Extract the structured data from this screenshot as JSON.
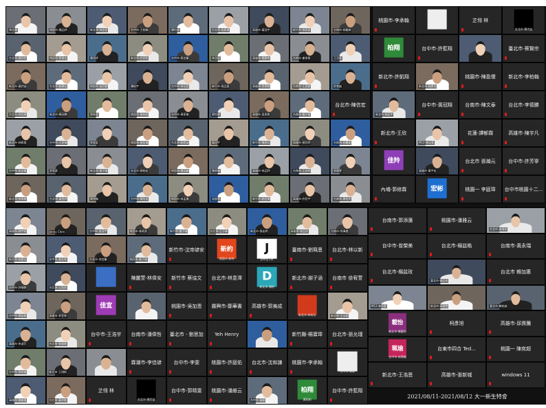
{
  "footer": {
    "caption": "2021/08/11-2021/08/12 大一新生特會"
  },
  "skin_tones": [
    "#e8c4a8",
    "#d9b294",
    "#f0d0b6",
    "#c99f80",
    "#e2bb9c"
  ],
  "video_bgs": [
    "#6b6e74",
    "#8a8d92",
    "#4d5c72",
    "#7a6b5e",
    "#5e6b7a",
    "#9aa0a6",
    "#3f4a5c",
    "#7c8591",
    "#6e655c",
    "#58636f",
    "#a49c90",
    "#4b6d8c",
    "#8c8c80",
    "#2f5e9e",
    "#6f7d6a"
  ],
  "panels": [
    {
      "id": "grid-a",
      "tiles": [
        {
          "kind": "video",
          "caption": "李佳穎"
        },
        {
          "kind": "video",
          "caption": "桃園市-陳品妤"
        },
        {
          "kind": "video",
          "caption": "新北市-林宜君"
        },
        {
          "kind": "video",
          "caption": "台中市-王柏翰"
        },
        {
          "kind": "video",
          "caption": "陳怡安"
        },
        {
          "kind": "video",
          "caption": "台北市-吳佩珊"
        },
        {
          "kind": "video",
          "caption": "高雄市-黃冠宇"
        },
        {
          "kind": "video",
          "caption": "新竹市-張家豪"
        },
        {
          "kind": "video",
          "caption": "台南市-林雅婷"
        },
        {
          "kind": "video",
          "caption": "台北市-周欣怡"
        },
        {
          "kind": "video",
          "caption": "桃園市-郭俊宏"
        },
        {
          "kind": "video",
          "caption": "陳思妤"
        },
        {
          "kind": "video",
          "caption": "新北市-許家銘"
        },
        {
          "kind": "video",
          "caption": "台中市-蔡宜蓁"
        },
        {
          "kind": "video",
          "caption": "林冠廷"
        },
        {
          "kind": "video",
          "caption": "高雄市-楊雅筑"
        },
        {
          "kind": "video",
          "caption": "台南市-謝承恩"
        },
        {
          "kind": "video",
          "caption": "王羽柔"
        },
        {
          "kind": "video",
          "caption": "新北市-黃詩涵"
        },
        {
          "kind": "video",
          "caption": "台北市-劉建宏"
        },
        {
          "kind": "video",
          "caption": "桃園市-吳欣穎"
        },
        {
          "kind": "video",
          "caption": "陳柏宇"
        },
        {
          "kind": "video",
          "caption": "台中市-林佳蓉"
        },
        {
          "kind": "video",
          "caption": "新竹市-張品萱"
        },
        {
          "kind": "video",
          "caption": "高雄市-李承翰"
        },
        {
          "kind": "video",
          "caption": "台南市-王思穎"
        },
        {
          "kind": "video",
          "caption": "許育誠"
        },
        {
          "kind": "video",
          "caption": "台北市-林宜臻"
        },
        {
          "kind": "video",
          "caption": "新北市-陳冠霖"
        },
        {
          "kind": "video",
          "caption": "蔡佩君"
        },
        {
          "kind": "video",
          "caption": "桃園市-黃柏翔"
        },
        {
          "kind": "video",
          "caption": "台中市-周家瑜"
        },
        {
          "kind": "video",
          "caption": "郭怡婷"
        },
        {
          "kind": "video",
          "caption": "高雄市-吳承恩"
        },
        {
          "kind": "video",
          "caption": "台南市-楊子萱"
        },
        {
          "kind": "name",
          "label": "台北市-陳信宏"
        },
        {
          "kind": "video",
          "caption": "新北市-林佩蓉"
        },
        {
          "kind": "video",
          "caption": "台中市-王家瑋"
        },
        {
          "kind": "video",
          "caption": "李宜庭"
        },
        {
          "kind": "video",
          "caption": "桃園市-張哲瑋"
        },
        {
          "kind": "video",
          "caption": "台北市-劉思涵"
        },
        {
          "kind": "video",
          "caption": "黃冠宇"
        },
        {
          "kind": "video",
          "caption": "新竹市-陳彥廷"
        },
        {
          "kind": "video",
          "caption": "高雄市-蔡欣妤"
        },
        {
          "kind": "video",
          "caption": "台南市-林書豪"
        },
        {
          "kind": "video",
          "caption": "台中市-吳宜蓁"
        },
        {
          "kind": "video",
          "caption": "許家豪"
        },
        {
          "kind": "video",
          "caption": "新北市-周子晴"
        },
        {
          "kind": "video",
          "caption": "台北市-郭柏宏"
        },
        {
          "kind": "video",
          "caption": "桃園市-楊佳穎"
        },
        {
          "kind": "video",
          "caption": "陳俊傑"
        },
        {
          "kind": "video",
          "caption": "高雄市-林品妤"
        },
        {
          "kind": "video",
          "caption": "台南市-王志明"
        },
        {
          "kind": "video",
          "caption": "張雅雯"
        },
        {
          "kind": "video",
          "caption": "新北市-李承諺"
        },
        {
          "kind": "video",
          "caption": "台北市-黃思妤"
        },
        {
          "kind": "video",
          "caption": "蔡宗翰"
        },
        {
          "kind": "video",
          "caption": "台中市-陳怡君"
        },
        {
          "kind": "video",
          "caption": "桃園市-林孟儒"
        },
        {
          "kind": "video",
          "caption": "吳俊賢"
        },
        {
          "kind": "video",
          "caption": "新竹市-劉宜珊"
        },
        {
          "kind": "video",
          "caption": "高雄市-許哲宇"
        },
        {
          "kind": "video",
          "caption": "台南市-周怡伶"
        }
      ]
    },
    {
      "id": "grid-b",
      "tiles": [
        {
          "kind": "name",
          "label": "桃園市-李承翰"
        },
        {
          "kind": "avatar",
          "glyph": "",
          "bg": "#eeeeee",
          "caption": ""
        },
        {
          "kind": "name",
          "label": "芷翎 林"
        },
        {
          "kind": "avatar",
          "glyph": "",
          "bg": "#000000",
          "caption": "台北市-陳宗益"
        },
        {
          "kind": "avatar",
          "glyph": "柏翔",
          "bg": "#2f8a3a",
          "caption": ""
        },
        {
          "kind": "name",
          "label": "台中市-許藍翔"
        },
        {
          "kind": "video",
          "caption": ""
        },
        {
          "kind": "name",
          "label": "臺北市-蔡賢宗"
        },
        {
          "kind": "name",
          "label": "新北市-許凱翔"
        },
        {
          "kind": "video",
          "caption": "新北市-林彥均"
        },
        {
          "kind": "name",
          "label": "桃園市-陳盈儒"
        },
        {
          "kind": "name",
          "label": "新北市-李柏翰"
        },
        {
          "kind": "video",
          "caption": "新北市-林廷宇"
        },
        {
          "kind": "name",
          "label": "台中市-黃冠翔"
        },
        {
          "kind": "name",
          "label": "台南市-陳文泰"
        },
        {
          "kind": "name",
          "label": "台北市-李德勝"
        },
        {
          "kind": "name",
          "label": "新北市-王欣"
        },
        {
          "kind": "video",
          "caption": "M12-林佳蓉"
        },
        {
          "kind": "name",
          "label": "花蓮-譚郁霖"
        },
        {
          "kind": "name",
          "label": "高雄市-陳宇凡"
        },
        {
          "kind": "avatar",
          "glyph": "佳羚",
          "bg": "#8e3fb8",
          "caption": ""
        },
        {
          "kind": "video",
          "caption": "高雄市-黃宇宏"
        },
        {
          "kind": "name",
          "label": "台北市 張瀚元"
        },
        {
          "kind": "name",
          "label": "台中市-許芳寧"
        },
        {
          "kind": "name",
          "label": "內埔-郭修霖"
        },
        {
          "kind": "avatar",
          "glyph": "宏彬",
          "bg": "#1f6fd1",
          "caption": ""
        },
        {
          "kind": "name",
          "label": "桃園一 李庭瑋"
        },
        {
          "kind": "name",
          "label": "台中市桃園十二..."
        }
      ]
    },
    {
      "id": "grid-c",
      "tiles": [
        {
          "kind": "video",
          "caption": "高雄市-林宇翔"
        },
        {
          "kind": "video",
          "caption": "Jenny Chen"
        },
        {
          "kind": "video",
          "caption": "台中市-吳冠宇"
        },
        {
          "kind": "video",
          "caption": "桃園市-林雨潔"
        },
        {
          "kind": "video",
          "caption": "新竹市-葉子晴"
        },
        {
          "kind": "video",
          "caption": "台北市-王子瑋"
        },
        {
          "kind": "video",
          "caption": "新北市-張宏明"
        },
        {
          "kind": "video",
          "caption": "高雄市-周品彤"
        },
        {
          "kind": "video",
          "caption": "台南市-徐偉倫"
        },
        {
          "kind": "video",
          "caption": "新北市-林晏佳"
        },
        {
          "kind": "video",
          "caption": "台中市-黃宣華"
        },
        {
          "kind": "video",
          "caption": "台北市-何宜蓁"
        },
        {
          "kind": "video",
          "caption": "桃園市-黃子瑜"
        },
        {
          "kind": "name",
          "label": "新竹市-沈帝諺安"
        },
        {
          "kind": "avatar",
          "glyph": "新約",
          "bg": "#e2461c",
          "caption": "桃園市-新約"
        },
        {
          "kind": "avatar",
          "glyph": "J",
          "bg": "#ffffff",
          "fg": "#111111",
          "caption": "Jenny Lin"
        },
        {
          "kind": "name",
          "label": "臺南市-劉珮恩"
        },
        {
          "kind": "name",
          "label": "台北市-林以新"
        },
        {
          "kind": "video",
          "caption": "台中市-許晴朗"
        },
        {
          "kind": "video",
          "caption": "台北市-王思齊"
        },
        {
          "kind": "avatar",
          "glyph": "",
          "bg": "#3a6fc4",
          "caption": ""
        },
        {
          "kind": "name",
          "label": "陳麗萱-林偉安"
        },
        {
          "kind": "name",
          "label": "新竹市 蔡協文"
        },
        {
          "kind": "name",
          "label": "台北市-林意澤"
        },
        {
          "kind": "avatar",
          "glyph": "D",
          "bg": "#2ba7b8",
          "caption": "新北市-陳柏"
        },
        {
          "kind": "name",
          "label": "新北市-謝子涵"
        },
        {
          "kind": "name",
          "label": "台南市 徐宥萱"
        },
        {
          "kind": "video",
          "caption": "台中市-陳盈穎"
        },
        {
          "kind": "video",
          "caption": "高雄市-李宣婷"
        },
        {
          "kind": "avatar",
          "glyph": "佳宜",
          "bg": "#9e3cb5",
          "caption": ""
        },
        {
          "kind": "video",
          "caption": ""
        },
        {
          "kind": "name",
          "label": "桃園市-吳加恩"
        },
        {
          "kind": "name",
          "label": "霧興市-鄭華書"
        },
        {
          "kind": "name",
          "label": "高雄市-郭夷成"
        },
        {
          "kind": "avatar",
          "glyph": "",
          "bg": "#d23a1c",
          "caption": "新北市-林有弘"
        },
        {
          "kind": "video",
          "caption": "新北市-王以諾"
        },
        {
          "kind": "video",
          "caption": "高雄市-李淑芬"
        },
        {
          "kind": "video",
          "caption": "台北市-張雅琳"
        },
        {
          "kind": "name",
          "label": "台中市-王浩宇"
        },
        {
          "kind": "name",
          "label": "台南市-潘偉哲"
        },
        {
          "kind": "name",
          "label": "臺北市 - 劉思加"
        },
        {
          "kind": "name",
          "label": "Yeh Henry"
        },
        {
          "kind": "video",
          "caption": ""
        },
        {
          "kind": "name",
          "label": "新竹縣-楊寶瑋"
        },
        {
          "kind": "name",
          "label": "台北市-張允瑾"
        },
        {
          "kind": "video",
          "caption": "台中市-周育璇"
        },
        {
          "kind": "video",
          "caption": "新北市-王翊帆"
        },
        {
          "kind": "video",
          "caption": ""
        },
        {
          "kind": "name",
          "label": "霖潮市-李佳諺"
        },
        {
          "kind": "name",
          "label": "台中市-李雯"
        },
        {
          "kind": "name",
          "label": "桃園市-許庭佑"
        },
        {
          "kind": "name",
          "label": "台北市-沈和謙"
        },
        {
          "kind": "name",
          "label": "桃園市-李承翰"
        },
        {
          "kind": "avatar",
          "glyph": "",
          "bg": "#eeeeee",
          "caption": "台中市-林家"
        },
        {
          "kind": "video",
          "caption": "高雄市-陳美惠"
        },
        {
          "kind": "video",
          "caption": "台北市-黃仲楷"
        },
        {
          "kind": "name",
          "label": "芷翎 林"
        },
        {
          "kind": "avatar",
          "glyph": "",
          "bg": "#000000",
          "caption": "台北市-陳宗益"
        },
        {
          "kind": "name",
          "label": "台中市-郭晴雯"
        },
        {
          "kind": "name",
          "label": "桃園市-潘維云"
        },
        {
          "kind": "video",
          "caption": "台中市-黃穎"
        },
        {
          "kind": "avatar",
          "glyph": "柏翔",
          "bg": "#2f8a3a",
          "caption": "黃佑柏"
        },
        {
          "kind": "name",
          "label": "台中市-許藍翔"
        }
      ]
    },
    {
      "id": "grid-d",
      "tiles": [
        {
          "kind": "name",
          "label": "台南市-郭添蓮"
        },
        {
          "kind": "name",
          "label": "桃園市-潘雅云"
        },
        {
          "kind": "video",
          "caption": "台北市 施靖棠"
        },
        {
          "kind": "name",
          "label": "台中市-曾榮美"
        },
        {
          "kind": "name",
          "label": "台北市-楊茲皓"
        },
        {
          "kind": "name",
          "label": "台南市-黃永瑞"
        },
        {
          "kind": "name",
          "label": "台北市-楊茲玫"
        },
        {
          "kind": "video",
          "caption": "臺北市-劉品秀"
        },
        {
          "kind": "name",
          "label": "台北市 賴加惠"
        },
        {
          "kind": "video",
          "caption": "M12-林佳蓉"
        },
        {
          "kind": "video",
          "caption": "新北市-高毓雯"
        },
        {
          "kind": "video",
          "caption": "臺北市-賴柏誠"
        },
        {
          "kind": "avatar",
          "glyph": "載怡",
          "bg": "#8a2f7e",
          "caption": "新北市-陳載怡"
        },
        {
          "kind": "name",
          "label": "柯彥旭"
        },
        {
          "kind": "name",
          "label": "高雄市-邱資騰"
        },
        {
          "kind": "avatar",
          "glyph": "珮瑜",
          "bg": "#c4255a",
          "caption": "台中市-林珮瑜"
        },
        {
          "kind": "name",
          "label": "台東市四合 Ted..."
        },
        {
          "kind": "name",
          "label": "桃園一 陳奕超"
        },
        {
          "kind": "name",
          "label": "新北市-王浩恩"
        },
        {
          "kind": "name",
          "label": "高雄市-張新城"
        },
        {
          "kind": "name",
          "label": "windows 11"
        }
      ]
    }
  ]
}
